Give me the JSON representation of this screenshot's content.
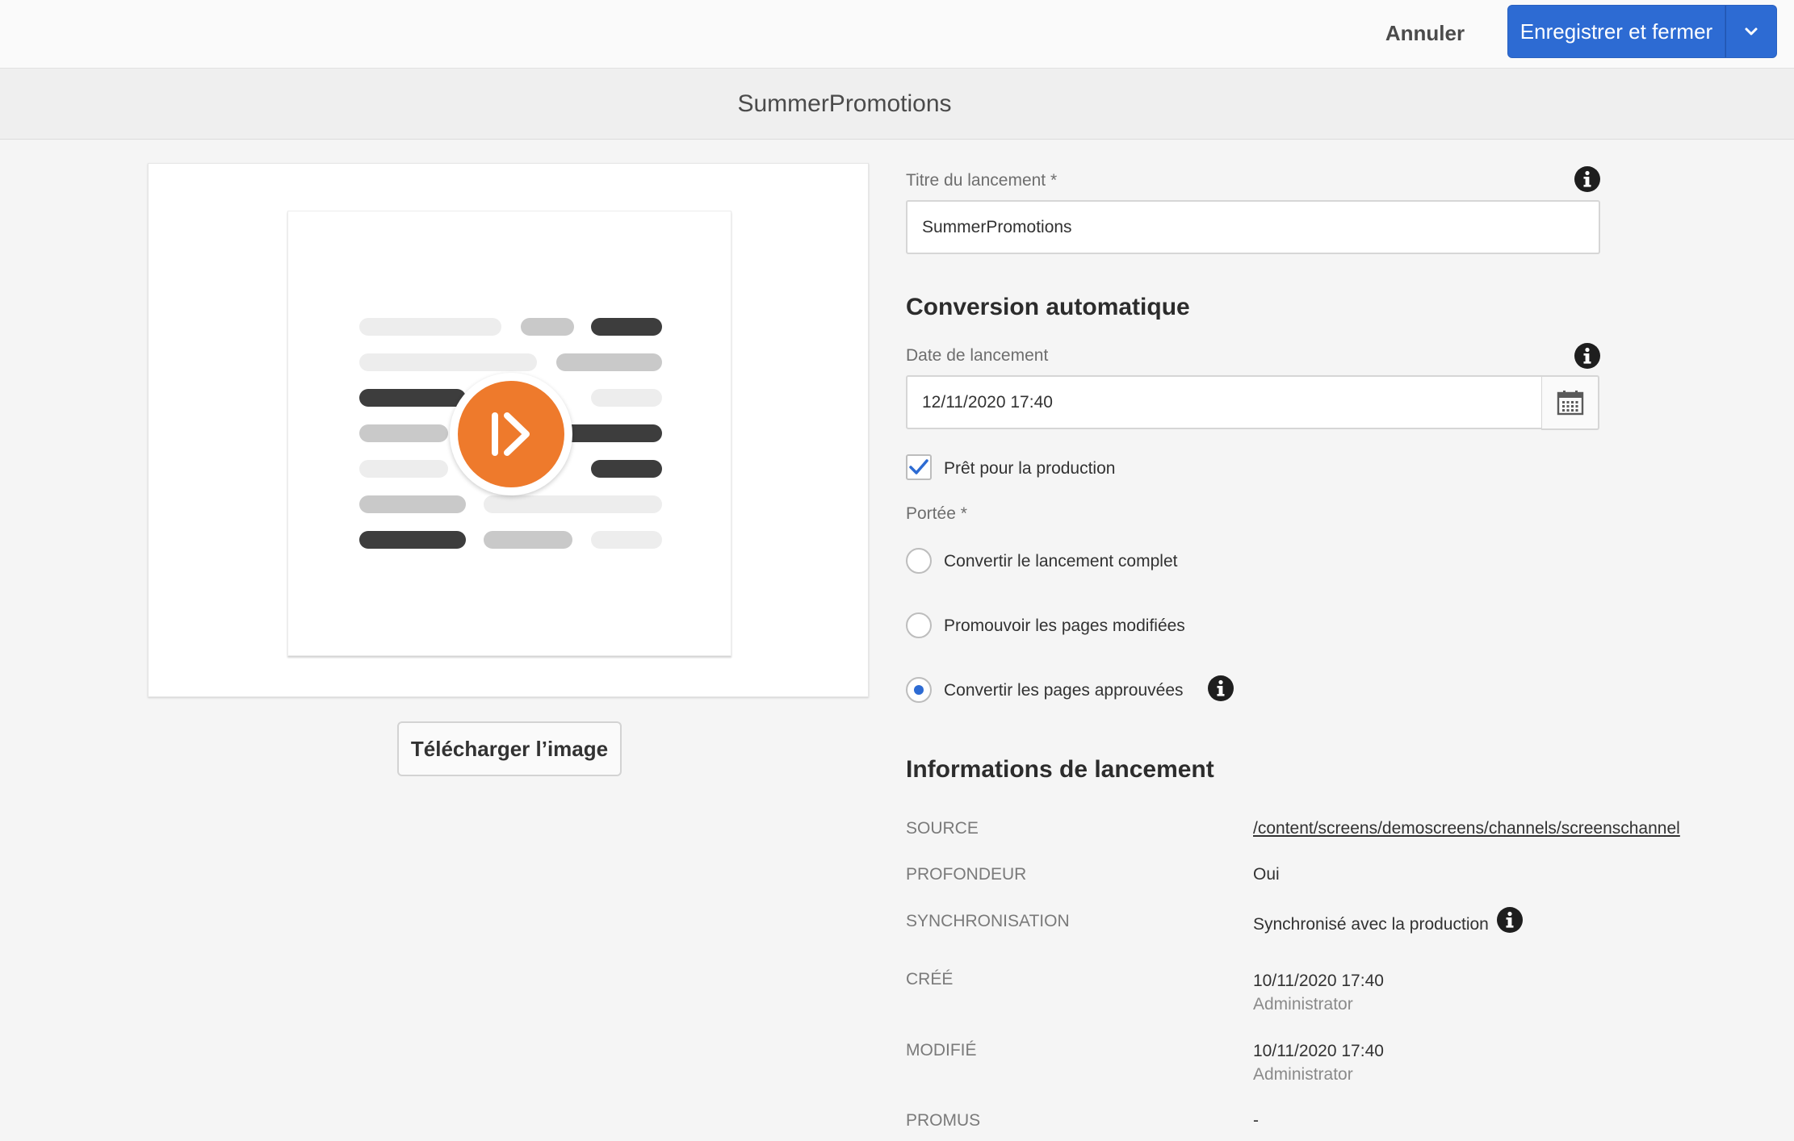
{
  "toolbar": {
    "cancel_label": "Annuler",
    "save_label": "Enregistrer et fermer"
  },
  "header": {
    "title": "SummerPromotions"
  },
  "thumbnail": {
    "upload_label": "Télécharger l’image"
  },
  "form": {
    "title_label": "Titre du lancement *",
    "title_value": "SummerPromotions",
    "auto_section": "Conversion automatique",
    "date_label": "Date de lancement",
    "date_value": "12/11/2020 17:40",
    "ready_label": "Prêt pour la production",
    "ready_checked": true,
    "scope_label": "Portée *",
    "scope_options": [
      {
        "label": "Convertir le lancement complet",
        "checked": false
      },
      {
        "label": "Promouvoir les pages modifiées",
        "checked": false
      },
      {
        "label": "Convertir les pages approuvées",
        "checked": true
      }
    ]
  },
  "info": {
    "section_title": "Informations de lancement",
    "source_key": "SOURCE",
    "source_value": "/content/screens/demoscreens/channels/screenschannel",
    "depth_key": "PROFONDEUR",
    "depth_value": "Oui",
    "sync_key": "SYNCHRONISATION",
    "sync_value": "Synchronisé avec la production",
    "created_key": "CRÉÉ",
    "created_date": "10/11/2020 17:40",
    "created_by": "Administrator",
    "modified_key": "MODIFIÉ",
    "modified_date": "10/11/2020 17:40",
    "modified_by": "Administrator",
    "promoted_key": "PROMUS",
    "promoted_value": "-"
  },
  "colors": {
    "accent": "#2d6bd3",
    "badge": "#ee7a2c"
  }
}
